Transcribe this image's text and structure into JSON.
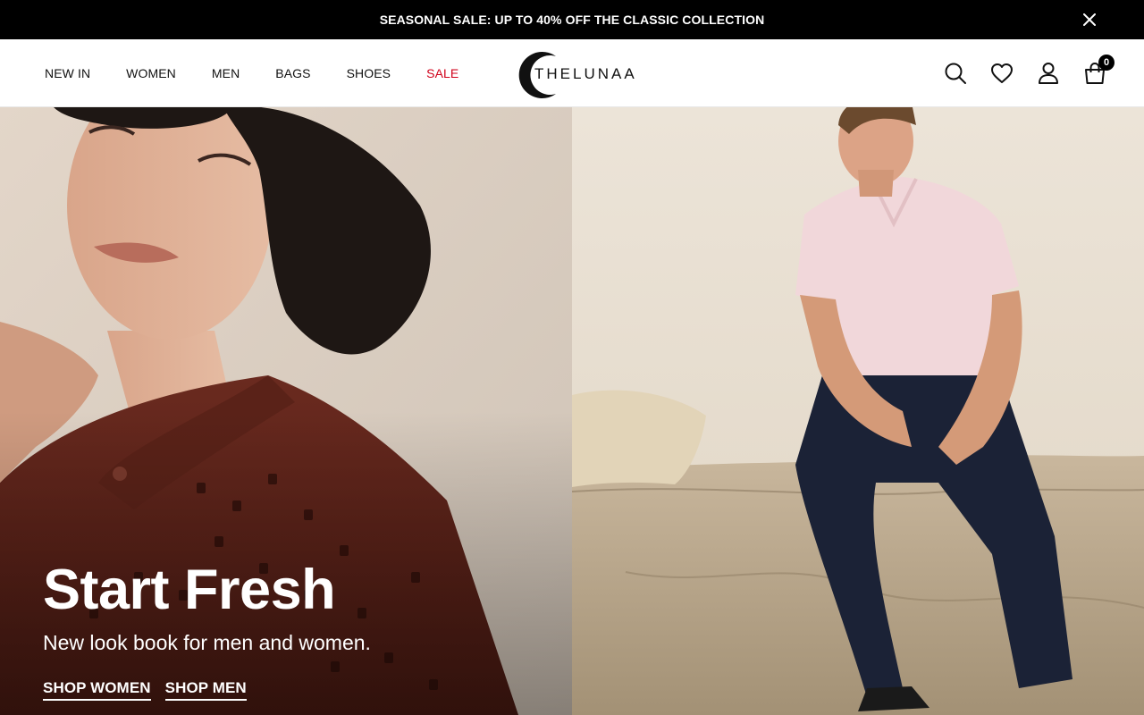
{
  "announcement": {
    "text": "SEASONAL SALE: UP TO 40% OFF THE CLASSIC COLLECTION",
    "close_icon": "close-icon"
  },
  "nav": {
    "items": [
      {
        "label": "NEW IN"
      },
      {
        "label": "WOMEN"
      },
      {
        "label": "MEN"
      },
      {
        "label": "BAGS"
      },
      {
        "label": "SHOES"
      },
      {
        "label": "SALE",
        "color": "#d0021b"
      }
    ]
  },
  "logo": {
    "text": "THELUNAA"
  },
  "header_icons": {
    "search": "search-icon",
    "wishlist": "heart-icon",
    "account": "user-icon",
    "cart": "shopping-bag-icon",
    "cart_count": "0"
  },
  "hero": {
    "title": "Start Fresh",
    "subtitle": "New look book for men and women.",
    "links": [
      "SHOP WOMEN",
      "SHOP MEN"
    ],
    "left_image": "woman in brown eyelet shirt with curly hair",
    "right_image": "man in pink polo and navy trousers sitting on stone ledge"
  },
  "colors": {
    "announcement_bg": "#000000",
    "sale_red": "#d0021b",
    "text": "#111111"
  }
}
